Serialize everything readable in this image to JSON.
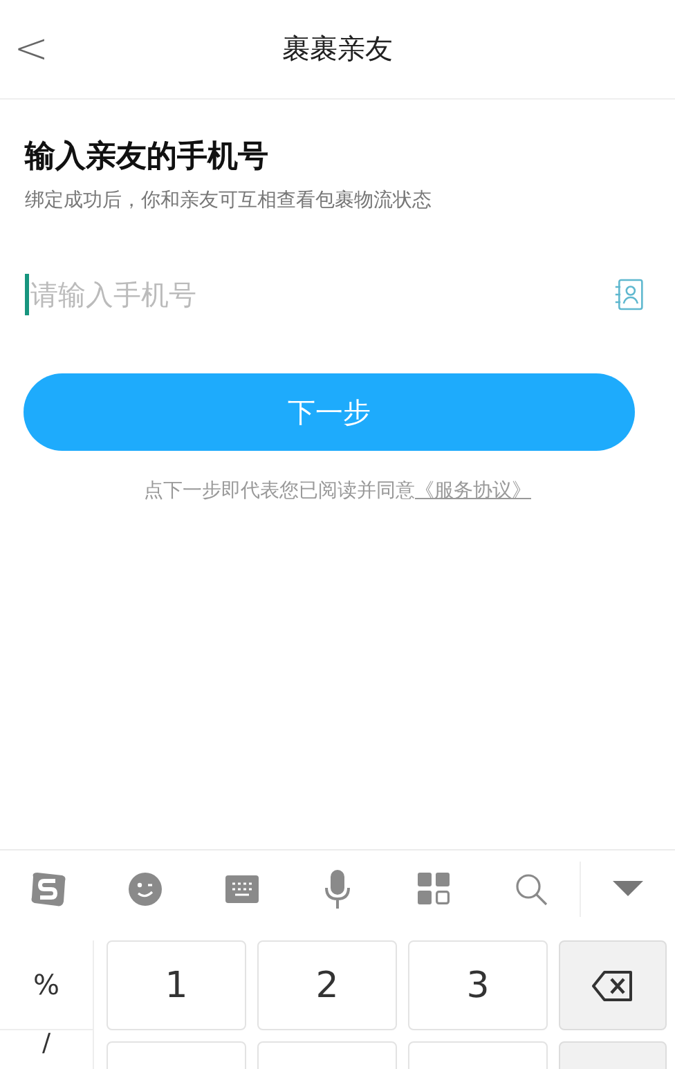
{
  "header": {
    "back": "<",
    "title": "裹裹亲友"
  },
  "heading": "输入亲友的手机号",
  "subtitle": "绑定成功后，你和亲友可互相查看包裹物流状态",
  "phone_field": {
    "placeholder": "请输入手机号"
  },
  "next_button": "下一步",
  "agreement": {
    "text": "点下一步即代表您已阅读并同意",
    "link": "《服务协议》"
  },
  "keyboard": {
    "toolbar": [
      {
        "kind": "logo"
      },
      {
        "kind": "emoji"
      },
      {
        "kind": "keyboard"
      },
      {
        "kind": "mic"
      },
      {
        "kind": "apps"
      },
      {
        "kind": "search"
      },
      {
        "kind": "collapse"
      }
    ],
    "symbols": [
      "%",
      "/"
    ],
    "rows": [
      [
        {
          "kind": "digit",
          "label": "1"
        },
        {
          "kind": "digit",
          "label": "2"
        },
        {
          "kind": "digit",
          "label": "3"
        },
        {
          "kind": "backspace"
        }
      ],
      [
        {
          "kind": "blank"
        },
        {
          "kind": "blank"
        },
        {
          "kind": "blank"
        },
        {
          "kind": "function"
        }
      ]
    ]
  }
}
